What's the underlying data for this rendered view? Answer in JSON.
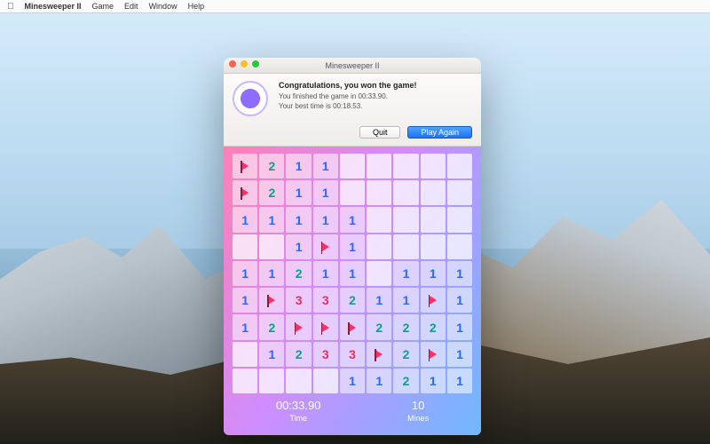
{
  "menubar": {
    "app": "Minesweeper II",
    "items": [
      "Game",
      "Edit",
      "Window",
      "Help"
    ]
  },
  "window": {
    "title": "Minesweeper II"
  },
  "alert": {
    "heading": "Congratulations, you won the game!",
    "line1": "You finished the game in 00:33.90.",
    "line2": "Your best time is 00:18.53.",
    "quit": "Quit",
    "play_again": "Play Again"
  },
  "status": {
    "time_value": "00:33.90",
    "time_label": "Time",
    "mines_value": "10",
    "mines_label": "Mines"
  },
  "board": {
    "size": 9,
    "rows": [
      [
        "F",
        "2",
        "1",
        "1",
        "",
        "",
        "",
        "",
        ""
      ],
      [
        "F",
        "2",
        "1",
        "1",
        "",
        "",
        "",
        "",
        ""
      ],
      [
        "1",
        "1",
        "1",
        "1",
        "1",
        "",
        "",
        "",
        ""
      ],
      [
        "",
        "",
        "1",
        "F",
        "1",
        "",
        "",
        "",
        ""
      ],
      [
        "1",
        "1",
        "2",
        "1",
        "1",
        "",
        "1",
        "1",
        "1"
      ],
      [
        "1",
        "F",
        "3",
        "3",
        "2",
        "1",
        "1",
        "F",
        "1"
      ],
      [
        "1",
        "2",
        "F",
        "F",
        "F",
        "2",
        "2",
        "2",
        "1"
      ],
      [
        "",
        "1",
        "2",
        "3",
        "3",
        "F",
        "2",
        "F",
        "1"
      ],
      [
        "",
        "",
        "",
        "",
        "1",
        "1",
        "2",
        "1",
        "1"
      ]
    ]
  }
}
